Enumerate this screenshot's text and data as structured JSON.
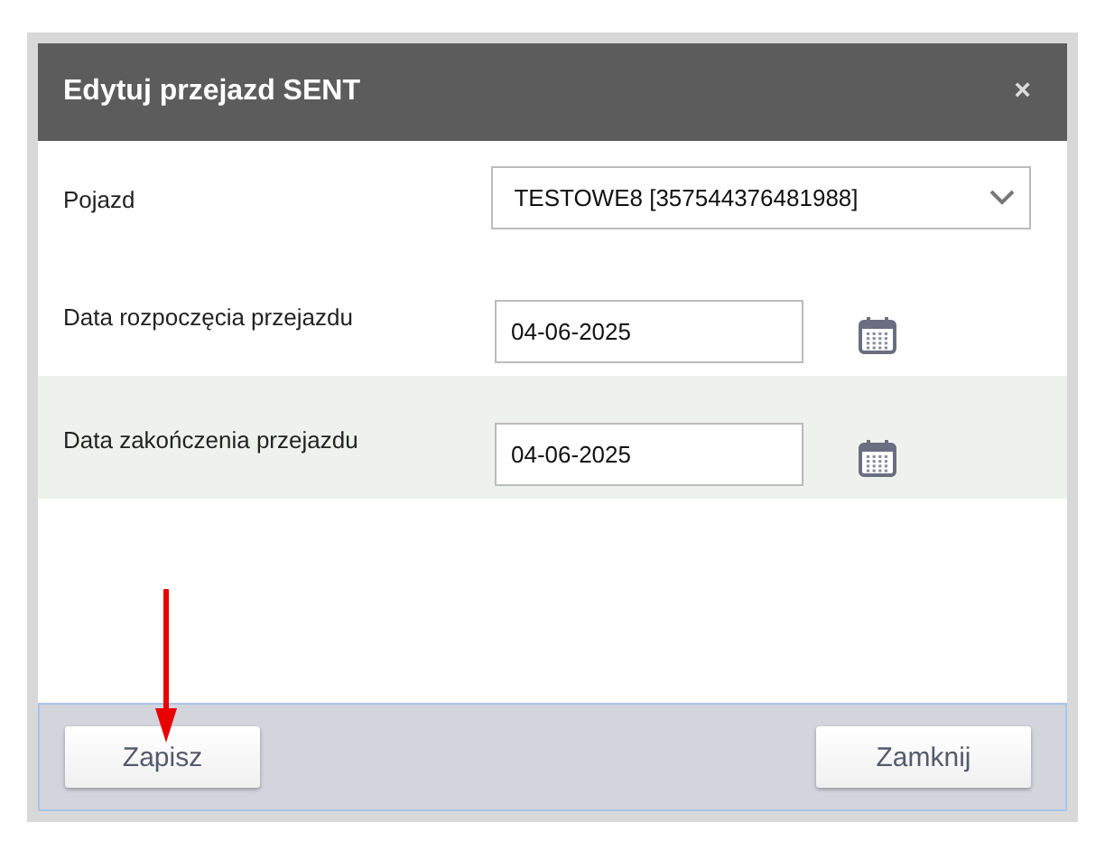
{
  "dialog": {
    "title": "Edytuj przejazd SENT",
    "close": "×"
  },
  "fields": [
    {
      "kind": "select",
      "label": "Pojazd",
      "value": "TESTOWE8 [357544376481988]",
      "highlighted": false
    },
    {
      "kind": "date",
      "label": "Data rozpoczęcia przejazdu",
      "value": "04-06-2025",
      "highlighted": false
    },
    {
      "kind": "date",
      "label": "Data zakończenia przejazdu",
      "value": "04-06-2025",
      "highlighted": true
    }
  ],
  "buttons": [
    "Zapisz",
    "Zamknij"
  ]
}
